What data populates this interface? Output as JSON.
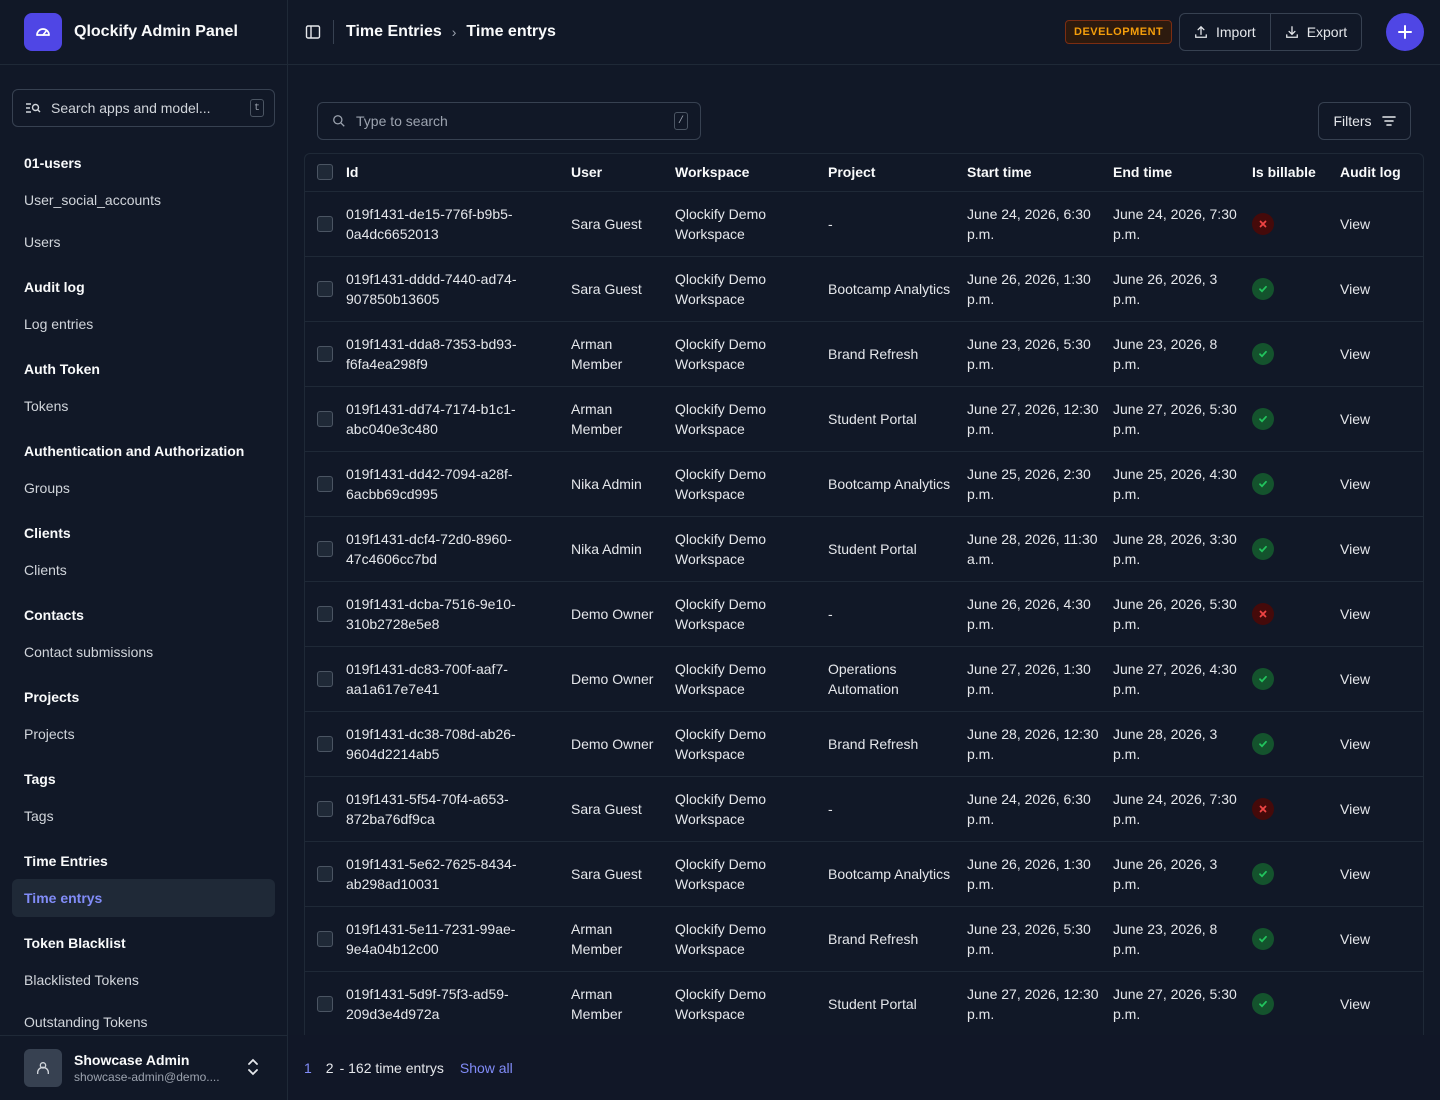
{
  "brand": {
    "title": "Qlockify Admin Panel"
  },
  "sidebar": {
    "search_placeholder": "Search apps and model...",
    "search_shortcut": "t",
    "groups": [
      {
        "heading": "01-users",
        "items": [
          {
            "label": "User_social_accounts"
          },
          {
            "label": "Users"
          }
        ]
      },
      {
        "heading": "Audit log",
        "items": [
          {
            "label": "Log entries"
          }
        ]
      },
      {
        "heading": "Auth Token",
        "items": [
          {
            "label": "Tokens"
          }
        ]
      },
      {
        "heading": "Authentication and Authorization",
        "items": [
          {
            "label": "Groups"
          }
        ]
      },
      {
        "heading": "Clients",
        "items": [
          {
            "label": "Clients"
          }
        ]
      },
      {
        "heading": "Contacts",
        "items": [
          {
            "label": "Contact submissions"
          }
        ]
      },
      {
        "heading": "Projects",
        "items": [
          {
            "label": "Projects"
          }
        ]
      },
      {
        "heading": "Tags",
        "items": [
          {
            "label": "Tags"
          }
        ]
      },
      {
        "heading": "Time Entries",
        "items": [
          {
            "label": "Time entrys",
            "active": true
          }
        ]
      },
      {
        "heading": "Token Blacklist",
        "items": [
          {
            "label": "Blacklisted Tokens"
          },
          {
            "label": "Outstanding Tokens"
          }
        ]
      }
    ],
    "user": {
      "name": "Showcase Admin",
      "email": "showcase-admin@demo...."
    }
  },
  "header": {
    "breadcrumb_parent": "Time Entries",
    "breadcrumb_current": "Time entrys",
    "env_badge": "DEVELOPMENT",
    "import_label": "Import",
    "export_label": "Export"
  },
  "toolbar": {
    "search_placeholder": "Type to search",
    "search_shortcut": "/",
    "filters_label": "Filters"
  },
  "table": {
    "columns": [
      "Id",
      "User",
      "Workspace",
      "Project",
      "Start time",
      "End time",
      "Is billable",
      "Audit log"
    ],
    "rows": [
      {
        "id": "019f1431-de15-776f-b9b5-0a4dc6652013",
        "user": "Sara Guest",
        "workspace": "Qlockify Demo Workspace",
        "project": "-",
        "start": "June 24, 2026, 6:30 p.m.",
        "end": "June 24, 2026, 7:30 p.m.",
        "billable": false,
        "audit": "View"
      },
      {
        "id": "019f1431-dddd-7440-ad74-907850b13605",
        "user": "Sara Guest",
        "workspace": "Qlockify Demo Workspace",
        "project": "Bootcamp Analytics",
        "start": "June 26, 2026, 1:30 p.m.",
        "end": "June 26, 2026, 3 p.m.",
        "billable": true,
        "audit": "View"
      },
      {
        "id": "019f1431-dda8-7353-bd93-f6fa4ea298f9",
        "user": "Arman Member",
        "workspace": "Qlockify Demo Workspace",
        "project": "Brand Refresh",
        "start": "June 23, 2026, 5:30 p.m.",
        "end": "June 23, 2026, 8 p.m.",
        "billable": true,
        "audit": "View"
      },
      {
        "id": "019f1431-dd74-7174-b1c1-abc040e3c480",
        "user": "Arman Member",
        "workspace": "Qlockify Demo Workspace",
        "project": "Student Portal",
        "start": "June 27, 2026, 12:30 p.m.",
        "end": "June 27, 2026, 5:30 p.m.",
        "billable": true,
        "audit": "View"
      },
      {
        "id": "019f1431-dd42-7094-a28f-6acbb69cd995",
        "user": "Nika Admin",
        "workspace": "Qlockify Demo Workspace",
        "project": "Bootcamp Analytics",
        "start": "June 25, 2026, 2:30 p.m.",
        "end": "June 25, 2026, 4:30 p.m.",
        "billable": true,
        "audit": "View"
      },
      {
        "id": "019f1431-dcf4-72d0-8960-47c4606cc7bd",
        "user": "Nika Admin",
        "workspace": "Qlockify Demo Workspace",
        "project": "Student Portal",
        "start": "June 28, 2026, 11:30 a.m.",
        "end": "June 28, 2026, 3:30 p.m.",
        "billable": true,
        "audit": "View"
      },
      {
        "id": "019f1431-dcba-7516-9e10-310b2728e5e8",
        "user": "Demo Owner",
        "workspace": "Qlockify Demo Workspace",
        "project": "-",
        "start": "June 26, 2026, 4:30 p.m.",
        "end": "June 26, 2026, 5:30 p.m.",
        "billable": false,
        "audit": "View"
      },
      {
        "id": "019f1431-dc83-700f-aaf7-aa1a617e7e41",
        "user": "Demo Owner",
        "workspace": "Qlockify Demo Workspace",
        "project": "Operations Automation",
        "start": "June 27, 2026, 1:30 p.m.",
        "end": "June 27, 2026, 4:30 p.m.",
        "billable": true,
        "audit": "View"
      },
      {
        "id": "019f1431-dc38-708d-ab26-9604d2214ab5",
        "user": "Demo Owner",
        "workspace": "Qlockify Demo Workspace",
        "project": "Brand Refresh",
        "start": "June 28, 2026, 12:30 p.m.",
        "end": "June 28, 2026, 3 p.m.",
        "billable": true,
        "audit": "View"
      },
      {
        "id": "019f1431-5f54-70f4-a653-872ba76df9ca",
        "user": "Sara Guest",
        "workspace": "Qlockify Demo Workspace",
        "project": "-",
        "start": "June 24, 2026, 6:30 p.m.",
        "end": "June 24, 2026, 7:30 p.m.",
        "billable": false,
        "audit": "View"
      },
      {
        "id": "019f1431-5e62-7625-8434-ab298ad10031",
        "user": "Sara Guest",
        "workspace": "Qlockify Demo Workspace",
        "project": "Bootcamp Analytics",
        "start": "June 26, 2026, 1:30 p.m.",
        "end": "June 26, 2026, 3 p.m.",
        "billable": true,
        "audit": "View"
      },
      {
        "id": "019f1431-5e11-7231-99ae-9e4a04b12c00",
        "user": "Arman Member",
        "workspace": "Qlockify Demo Workspace",
        "project": "Brand Refresh",
        "start": "June 23, 2026, 5:30 p.m.",
        "end": "June 23, 2026, 8 p.m.",
        "billable": true,
        "audit": "View"
      },
      {
        "id": "019f1431-5d9f-75f3-ad59-209d3e4d972a",
        "user": "Arman Member",
        "workspace": "Qlockify Demo Workspace",
        "project": "Student Portal",
        "start": "June 27, 2026, 12:30 p.m.",
        "end": "June 27, 2026, 5:30 p.m.",
        "billable": true,
        "audit": "View"
      }
    ]
  },
  "pagination": {
    "page1": "1",
    "page2": "2",
    "count": "- 162 time entrys",
    "show_all": "Show all"
  },
  "colors": {
    "accent": "#4f46e5",
    "billable_yes": "#22c55e",
    "billable_no": "#ef4444",
    "env_badge": "#f59e0b"
  }
}
